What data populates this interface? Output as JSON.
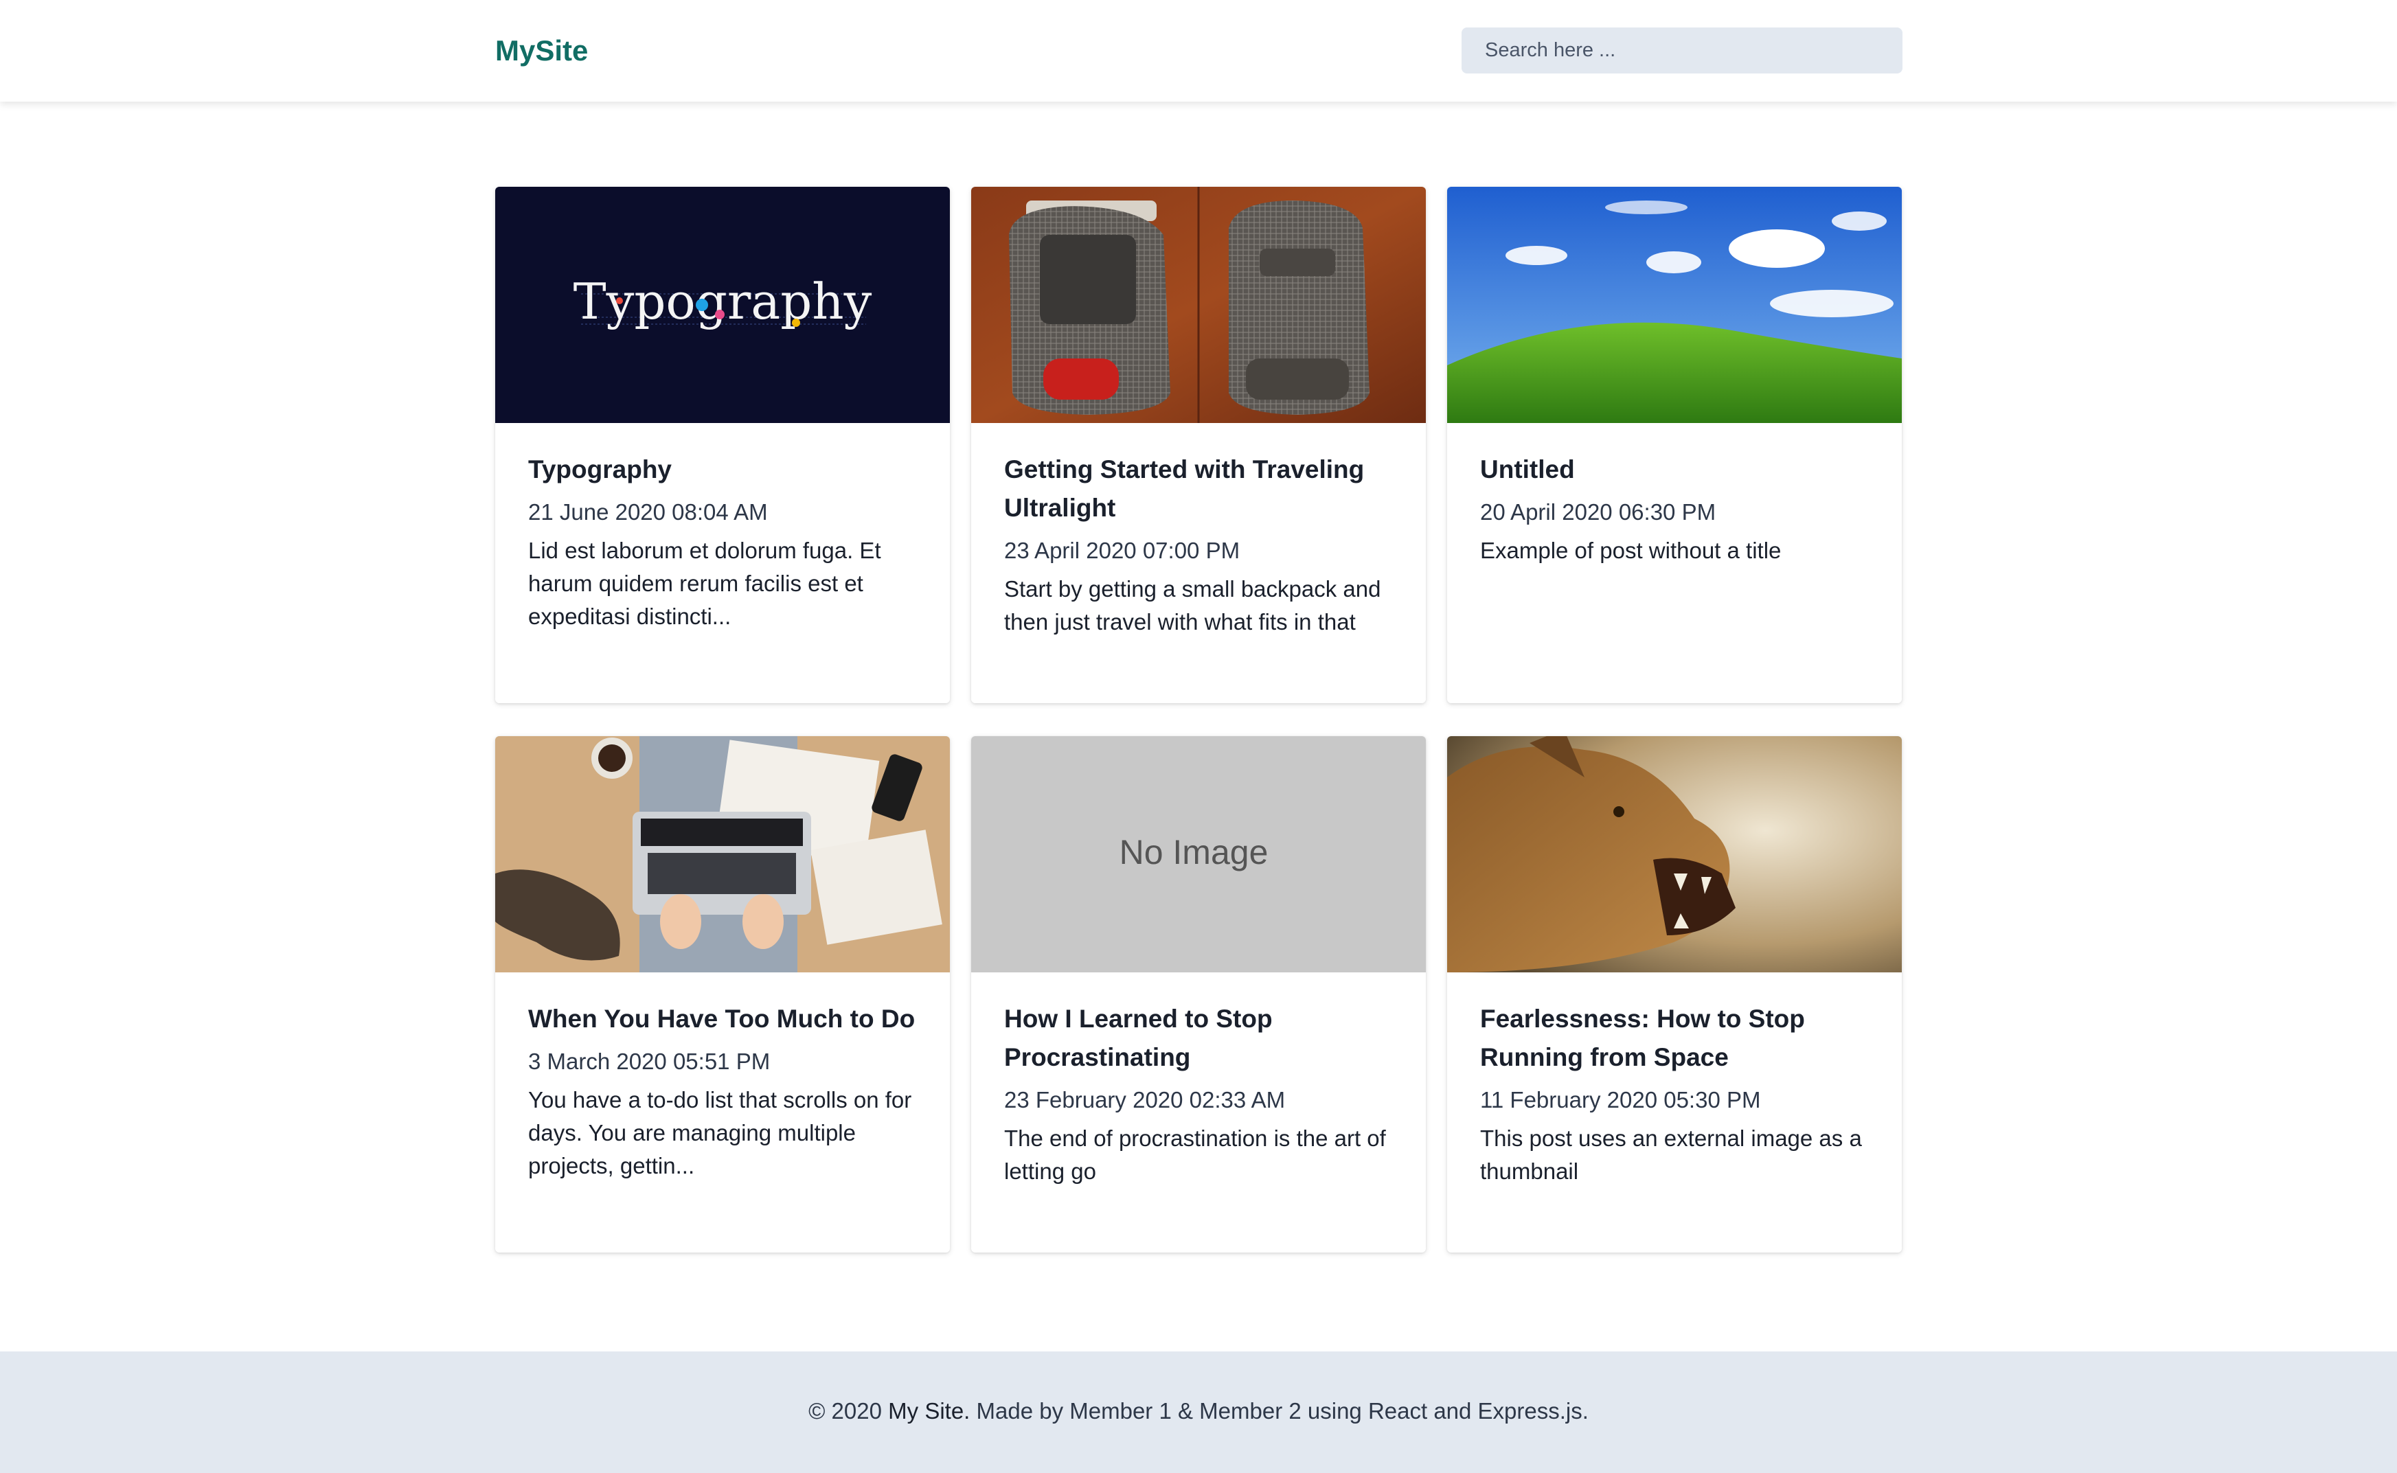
{
  "header": {
    "brand": "MySite",
    "search_placeholder": "Search here ..."
  },
  "posts": [
    {
      "title": "Typography",
      "date": "21 June 2020 08:04 AM",
      "excerpt": "Lid est laborum et dolorum fuga. Et harum quidem rerum facilis est et expeditasi distincti...",
      "thumbnail": {
        "kind": "typography-banner",
        "text": "Typography",
        "background": "#0b0d2b"
      }
    },
    {
      "title": "Getting Started with Traveling Ultralight",
      "date": "23 April 2020 07:00 PM",
      "excerpt": "Start by getting a small backpack and then just travel with what fits in that",
      "thumbnail": {
        "kind": "backpacks-photo"
      }
    },
    {
      "title": "Untitled",
      "date": "20 April 2020 06:30 PM",
      "excerpt": "Example of post without a title",
      "thumbnail": {
        "kind": "green-hill-photo"
      }
    },
    {
      "title": "When You Have Too Much to Do",
      "date": "3 March 2020 05:51 PM",
      "excerpt": "You have a to-do list that scrolls on for days. You are managing multiple projects, gettin...",
      "thumbnail": {
        "kind": "laptop-desk-photo"
      }
    },
    {
      "title": "How I Learned to Stop Procrastinating",
      "date": "23 February 2020 02:33 AM",
      "excerpt": "The end of procrastination is the art of letting go",
      "thumbnail": {
        "kind": "placeholder",
        "text": "No Image",
        "background": "#c8c8c8"
      }
    },
    {
      "title": "Fearlessness: How to Stop Running from Space",
      "date": "11 February 2020 05:30 PM",
      "excerpt": "This post uses an external image as a thumbnail",
      "thumbnail": {
        "kind": "lioness-photo"
      }
    }
  ],
  "footer": {
    "copyright": "© 2020",
    "site_name": "My Site.",
    "credits": "Made by Member 1 & Member 2 using React and Express.js."
  },
  "colors": {
    "brand": "#116d64",
    "footer_bg": "#e2e8f0",
    "search_bg": "#e2e8f0"
  }
}
